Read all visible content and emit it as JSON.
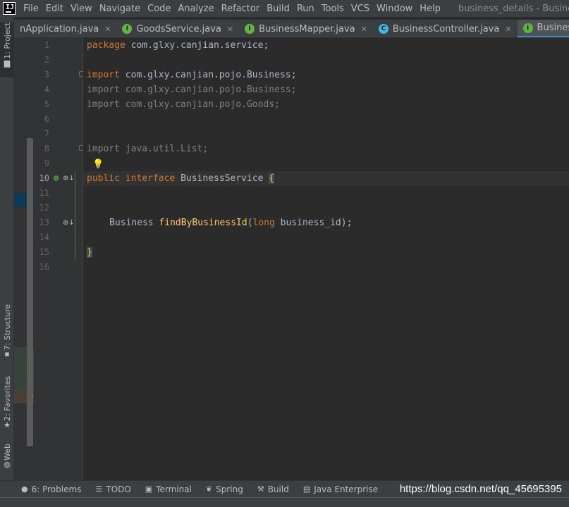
{
  "menubar": {
    "items": [
      "File",
      "Edit",
      "View",
      "Navigate",
      "Code",
      "Analyze",
      "Refactor",
      "Build",
      "Run",
      "Tools",
      "VCS",
      "Window",
      "Help"
    ],
    "window_title": "business_details - BusinessService.java"
  },
  "tabs": [
    {
      "label": "nApplication.java",
      "icon": "application-class-icon",
      "close": "✕"
    },
    {
      "label": "GoodsService.java",
      "icon": "interface-icon",
      "icon_letter": "I",
      "close": "✕"
    },
    {
      "label": "BusinessMapper.java",
      "icon": "interface-icon",
      "icon_letter": "I",
      "close": "✕"
    },
    {
      "label": "BusinessController.java",
      "icon": "class-icon",
      "icon_letter": "C",
      "close": "✕"
    },
    {
      "label": "BusinessService.java",
      "icon": "interface-icon",
      "icon_letter": "I",
      "active": true
    }
  ],
  "left_tools": {
    "project": "1: Project",
    "structure": "7: Structure",
    "favorites": "2: Favorites",
    "web": "Web"
  },
  "editor": {
    "current_line": 10,
    "line_numbers": [
      "1",
      "2",
      "3",
      "4",
      "5",
      "6",
      "7",
      "8",
      "9",
      "10",
      "11",
      "12",
      "13",
      "14",
      "15",
      "16"
    ],
    "lines": {
      "l1_kw": "package",
      "l1_rest": " com.glxy.canjian.service;",
      "l3_kw": "import",
      "l3_rest": " com.glxy.canjian.pojo.Business;",
      "l4": "import com.glxy.canjian.pojo.Business;",
      "l5": "import com.glxy.canjian.pojo.Goods;",
      "l8": "import java.util.List;",
      "l10_kw1": "public",
      "l10_kw2": "interface",
      "l10_name": "BusinessService",
      "l10_brace": "{",
      "l13_type": "Business",
      "l13_method": "findByBusinessId",
      "l13_paren_open": "(",
      "l13_kw": "long",
      "l13_param": " business_id",
      "l13_end": ");",
      "l15_brace": "}"
    }
  },
  "bottom_tools": [
    {
      "label": "6: Problems",
      "icon": "problems-icon"
    },
    {
      "label": "TODO",
      "icon": "todo-icon"
    },
    {
      "label": "Terminal",
      "icon": "terminal-icon"
    },
    {
      "label": "Spring",
      "icon": "spring-icon"
    },
    {
      "label": "Build",
      "icon": "build-icon"
    },
    {
      "label": "Java Enterprise",
      "icon": "java-enterprise-icon"
    }
  ],
  "watermark": "https://blog.csdn.net/qq_45695395",
  "colors": {
    "keyword": "#cc7832",
    "method": "#ffc66d",
    "text": "#a9b7c6",
    "unused_import": "#808080",
    "active_tab_underline": "#4a88c7"
  }
}
